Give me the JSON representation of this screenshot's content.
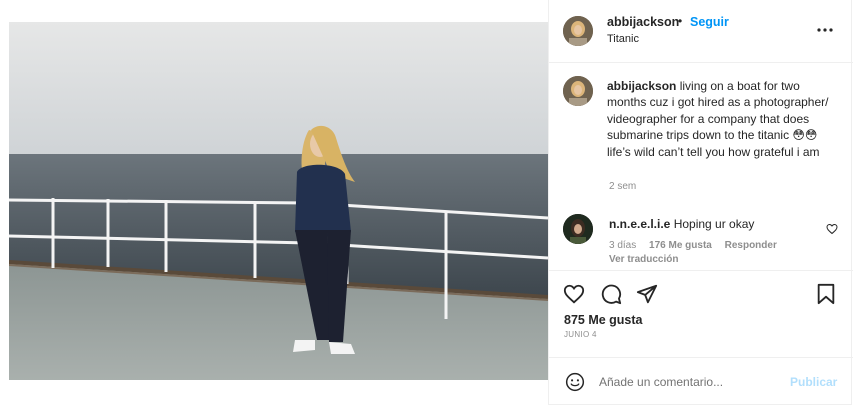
{
  "post": {
    "author": {
      "username": "abbijackson",
      "follow_label": "Seguir",
      "separator": "•",
      "location": "Titanic"
    },
    "caption": {
      "username": "abbijackson",
      "text": " living on a boat for two months cuz i got hired as a photographer/ videographer for a company that does submarine trips down to the titanic 😳😳 life’s wild can’t tell you how grateful i am",
      "age": "2 sem"
    },
    "comments": [
      {
        "username": "n.n.e.e.l.i.e",
        "text": " Hoping ur okay",
        "age": "3 días",
        "likes_label": "176 Me gusta",
        "reply_label": "Responder",
        "translate_label": "Ver traducción"
      }
    ],
    "likes_label": "875 Me gusta",
    "date_label": "JUNIO 4",
    "add_comment": {
      "placeholder": "Añade un comentario...",
      "publish_label": "Publicar"
    },
    "icons": {
      "more": "more-options-icon",
      "like": "heart-icon",
      "comment": "comment-icon",
      "share": "share-icon",
      "save": "bookmark-icon",
      "emoji": "emoji-icon",
      "comment_like": "heart-icon"
    },
    "colors": {
      "accent": "#0095f6",
      "publish_disabled": "#b2dffc",
      "secondary_text": "#8e8e8e",
      "border": "#efefef"
    }
  }
}
